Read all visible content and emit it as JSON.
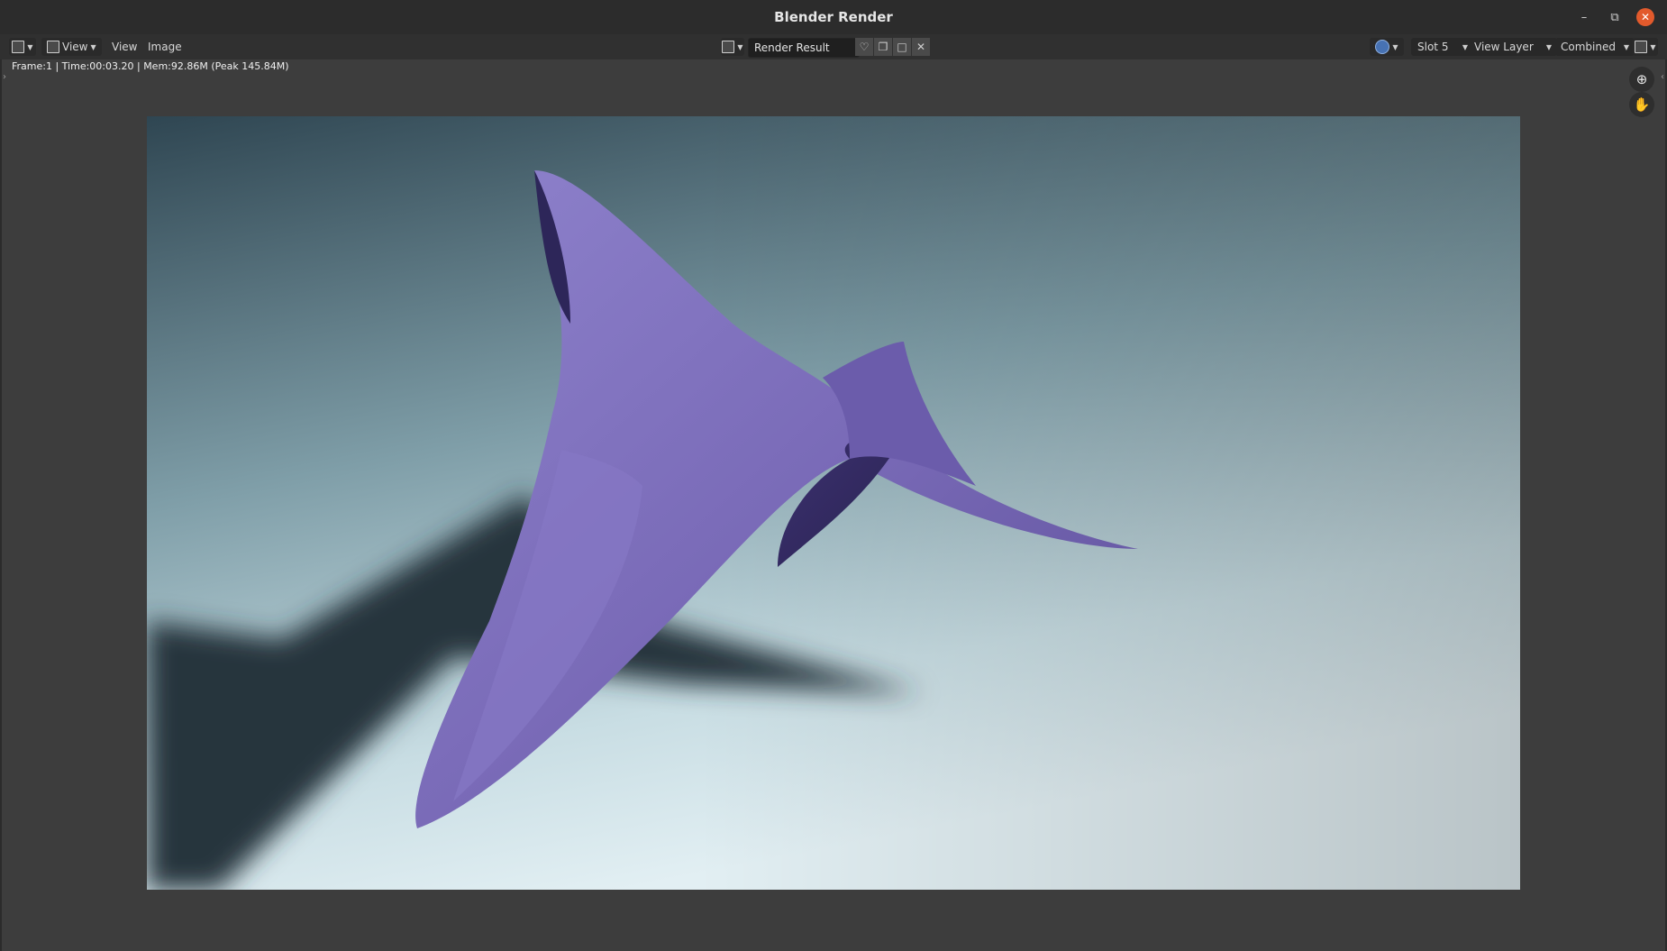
{
  "window": {
    "title": "Blender Render",
    "minimize_icon": "minimize-icon",
    "maximize_icon": "restore-icon",
    "close_icon": "close-icon"
  },
  "header": {
    "editor_type_icon": "image-editor-icon",
    "view_mode_label": "View",
    "menus": {
      "view": "View",
      "image": "Image"
    },
    "image_name": "Render Result",
    "image_tools": [
      "fake-user-icon",
      "new-image-icon",
      "open-image-icon",
      "unlink-icon"
    ],
    "slot": "Slot 5",
    "view_layer": "View Layer",
    "pass": "Combined"
  },
  "info": {
    "text": "Frame:1 | Time:00:03.20 | Mem:92.86M (Peak 145.84M)"
  },
  "navigation": {
    "zoom_icon": "zoom-icon",
    "pan_icon": "hand-pan-icon"
  },
  "render": {
    "description_colors": {
      "background_top": "#2f4652",
      "background_bottom": "#e2eff3",
      "object": "#7b6cb8",
      "shadow": "#27363e"
    }
  },
  "colors": {
    "accent": "#4772b3",
    "close": "#e25a2c"
  }
}
